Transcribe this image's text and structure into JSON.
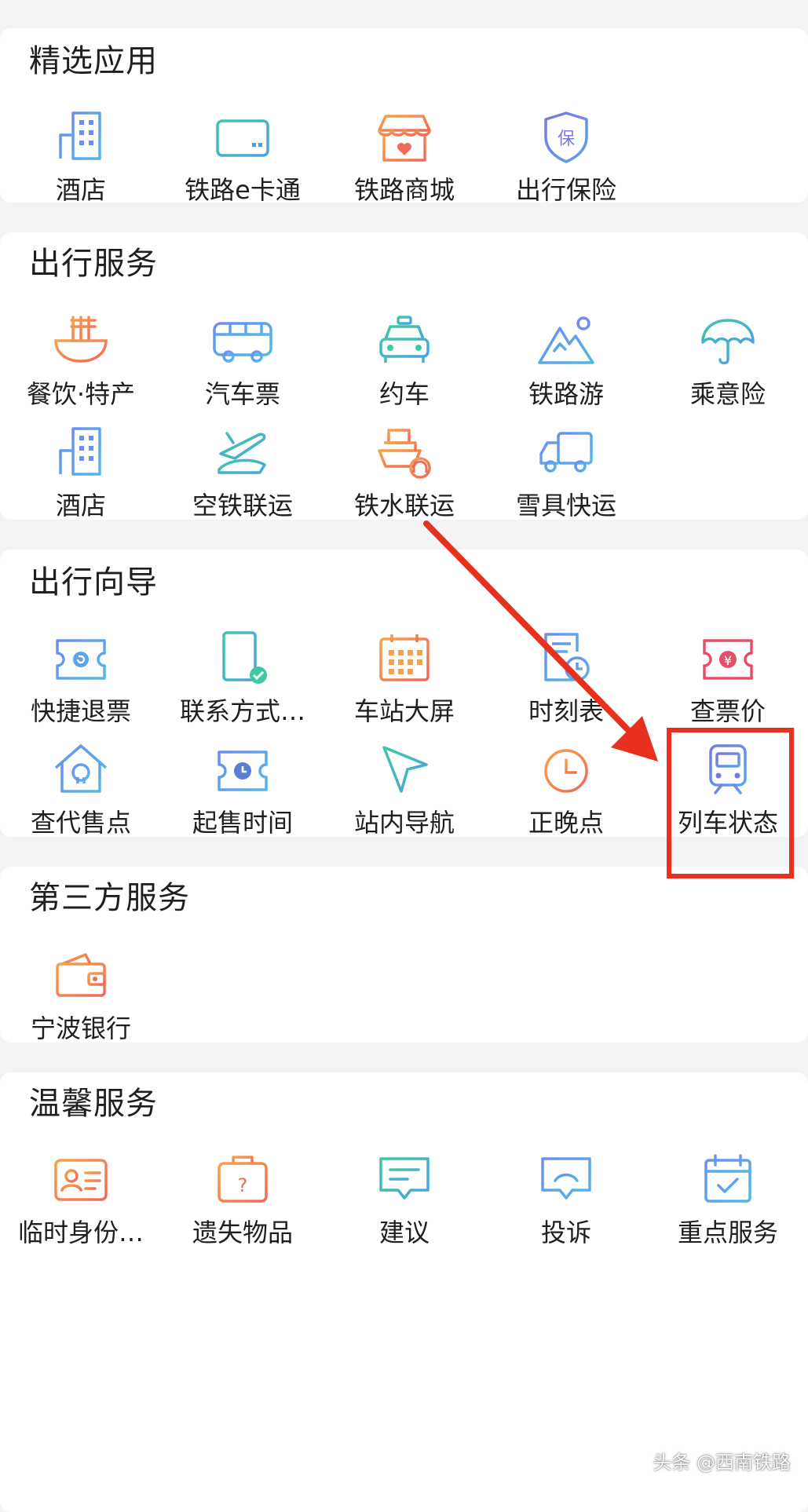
{
  "sections": {
    "featured": {
      "title": "精选应用",
      "items": [
        {
          "label": "酒店",
          "icon": "hotel-icon"
        },
        {
          "label": "铁路e卡通",
          "icon": "rail-ecard-icon"
        },
        {
          "label": "铁路商城",
          "icon": "mall-icon"
        },
        {
          "label": "出行保险",
          "icon": "travel-insurance-icon"
        }
      ]
    },
    "travel_services": {
      "title": "出行服务",
      "items": [
        {
          "label": "餐饮·特产",
          "icon": "noodle-bowl-icon"
        },
        {
          "label": "汽车票",
          "icon": "bus-icon"
        },
        {
          "label": "约车",
          "icon": "taxi-icon"
        },
        {
          "label": "铁路游",
          "icon": "mountain-icon"
        },
        {
          "label": "乘意险",
          "icon": "umbrella-icon"
        },
        {
          "label": "酒店",
          "icon": "hotel-icon"
        },
        {
          "label": "空铁联运",
          "icon": "plane-train-icon"
        },
        {
          "label": "铁水联运",
          "icon": "ship-train-icon"
        },
        {
          "label": "雪具快运",
          "icon": "truck-icon"
        }
      ]
    },
    "travel_guide": {
      "title": "出行向导",
      "items": [
        {
          "label": "快捷退票",
          "icon": "refund-ticket-icon"
        },
        {
          "label": "联系方式…",
          "icon": "phone-contact-icon"
        },
        {
          "label": "车站大屏",
          "icon": "station-screen-icon"
        },
        {
          "label": "时刻表",
          "icon": "timetable-icon"
        },
        {
          "label": "查票价",
          "icon": "ticket-price-icon"
        },
        {
          "label": "查代售点",
          "icon": "agency-point-icon"
        },
        {
          "label": "起售时间",
          "icon": "sale-time-icon"
        },
        {
          "label": "站内导航",
          "icon": "navigation-icon"
        },
        {
          "label": "正晚点",
          "icon": "clock-icon"
        },
        {
          "label": "列车状态",
          "icon": "train-icon"
        }
      ]
    },
    "third_party": {
      "title": "第三方服务",
      "items": [
        {
          "label": "宁波银行",
          "icon": "wallet-icon"
        }
      ]
    },
    "warm_services": {
      "title": "温馨服务",
      "items": [
        {
          "label": "临时身份…",
          "icon": "id-card-icon"
        },
        {
          "label": "遗失物品",
          "icon": "lost-bag-icon"
        },
        {
          "label": "建议",
          "icon": "suggestion-icon"
        },
        {
          "label": "投诉",
          "icon": "complaint-icon"
        },
        {
          "label": "重点服务",
          "icon": "calendar-check-icon"
        }
      ]
    }
  },
  "watermark": "头条 @西南铁路",
  "colors": {
    "blue": "#5b7fd6",
    "teal": "#36b8a6",
    "orange": "#f29a4a",
    "red": "#e8301e",
    "highlight": "#e8301e"
  }
}
